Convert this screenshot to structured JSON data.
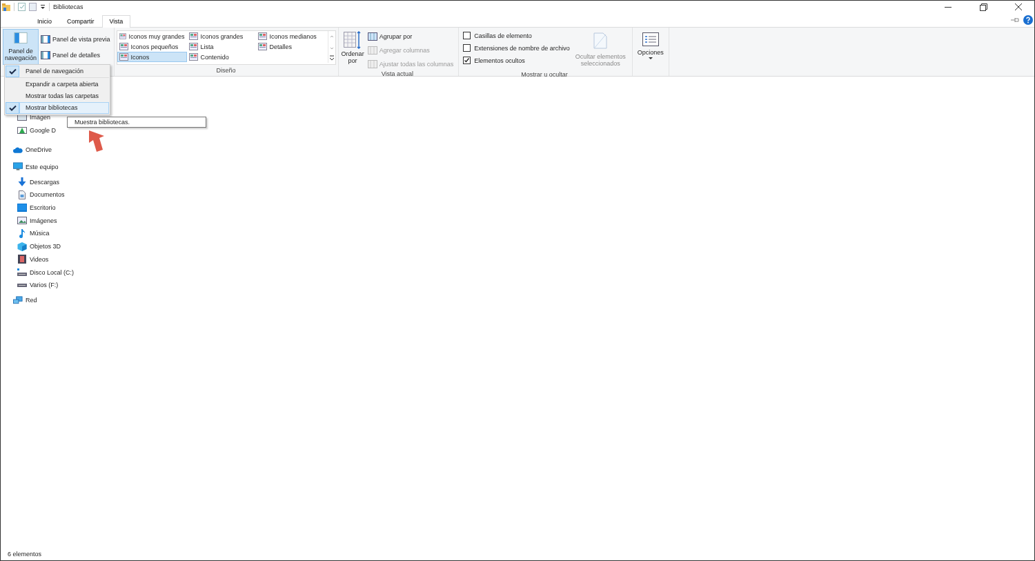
{
  "window": {
    "title": "Bibliotecas"
  },
  "tabs": [
    {
      "label": "Inicio",
      "selected": false
    },
    {
      "label": "Compartir",
      "selected": false
    },
    {
      "label": "Vista",
      "selected": true
    }
  ],
  "ribbon": {
    "panes": {
      "nav_button": {
        "label_lines": [
          "Panel de",
          "navegación"
        ],
        "selected": true
      },
      "items": [
        "Panel de vista previa",
        "Panel de detalles"
      ]
    },
    "layout": {
      "group_label": "Diseño",
      "options": [
        {
          "label": "Iconos muy grandes",
          "selected": false
        },
        {
          "label": "Iconos pequeños",
          "selected": false
        },
        {
          "label": "Iconos",
          "selected": true
        },
        {
          "label": "Iconos grandes",
          "selected": false
        },
        {
          "label": "Lista",
          "selected": false
        },
        {
          "label": "Contenido",
          "selected": false
        },
        {
          "label": "Iconos medianos",
          "selected": false
        },
        {
          "label": "Detalles",
          "selected": false
        }
      ]
    },
    "current_view": {
      "group_label": "Vista actual",
      "sort_lines": [
        "Ordenar",
        "por"
      ],
      "items": [
        {
          "label": "Agrupar por",
          "disabled": false
        },
        {
          "label": "Agregar columnas",
          "disabled": true
        },
        {
          "label": "Ajustar todas las columnas",
          "disabled": true
        }
      ]
    },
    "show_hide": {
      "group_label": "Mostrar u ocultar",
      "checkboxes": [
        {
          "label": "Casillas de elemento",
          "checked": false
        },
        {
          "label": "Extensiones de nombre de archivo",
          "checked": false
        },
        {
          "label": "Elementos ocultos",
          "checked": true
        }
      ],
      "hide_selected": {
        "label_lines": [
          "Ocultar elementos",
          "seleccionados"
        ],
        "disabled": true
      }
    },
    "options": {
      "label": "Opciones"
    }
  },
  "nav_menu": {
    "items": [
      {
        "label": "Panel de navegación",
        "checked": true,
        "selected": false
      },
      {
        "label": "Expandir a carpeta abierta",
        "checked": false,
        "selected": false
      },
      {
        "label": "Mostrar todas las carpetas",
        "checked": false,
        "selected": false
      },
      {
        "label": "Mostrar bibliotecas",
        "checked": true,
        "selected": true
      }
    ]
  },
  "tooltip": "Muestra bibliotecas.",
  "nav_pane": {
    "quick_access_visible": [
      {
        "label": "Imágen",
        "kind": "pictures"
      },
      {
        "label": "Google D",
        "kind": "gdrive"
      }
    ],
    "tree": [
      {
        "label": "OneDrive",
        "kind": "cloud"
      },
      {
        "label": "Este equipo",
        "kind": "pc",
        "children": [
          {
            "label": "Descargas",
            "kind": "download"
          },
          {
            "label": "Documentos",
            "kind": "docs"
          },
          {
            "label": "Escritorio",
            "kind": "desktop"
          },
          {
            "label": "Imágenes",
            "kind": "pictures"
          },
          {
            "label": "Música",
            "kind": "music"
          },
          {
            "label": "Objetos 3D",
            "kind": "cube"
          },
          {
            "label": "Videos",
            "kind": "video"
          },
          {
            "label": "Disco Local (C:)",
            "kind": "disk"
          },
          {
            "label": "Varios (F:)",
            "kind": "drive"
          }
        ]
      },
      {
        "label": "Red",
        "kind": "network"
      }
    ]
  },
  "status_bar": {
    "count": "6 elementos"
  }
}
